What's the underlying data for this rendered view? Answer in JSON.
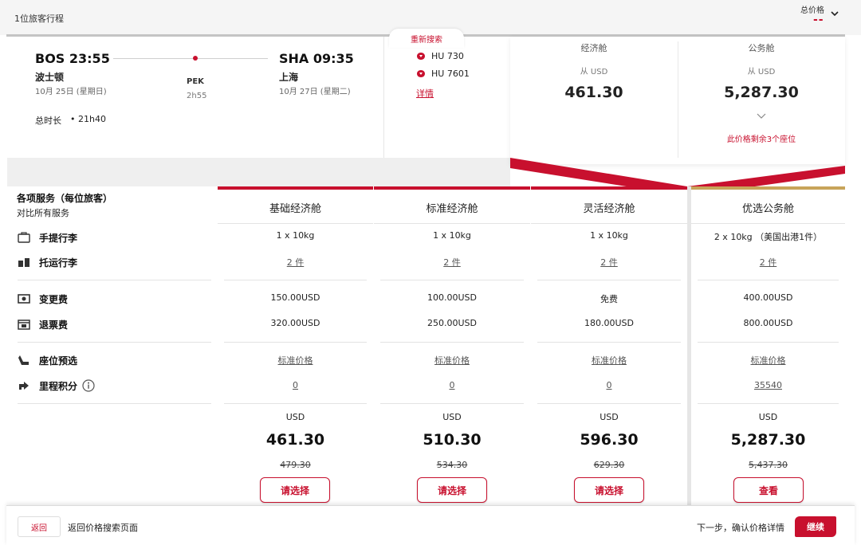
{
  "header": {
    "travelers": "1位旅客行程",
    "total_label": "总价格",
    "total_value": "--"
  },
  "flight": {
    "origin": "BOS 23:55",
    "origin_city": "波士顿",
    "origin_date": "10月 25日 (星期日)",
    "destination": "SHA 09:35",
    "destination_city": "上海",
    "destination_date": "10月 27日 (星期二)",
    "stop": "PEK",
    "layover": "2h55",
    "duration_label": "总时长",
    "duration": "•  21h40"
  },
  "research_label": "重新搜索",
  "flight_numbers": [
    "HU 730",
    "HU 7601"
  ],
  "details_link": "详情",
  "cabins": [
    {
      "name": "经济舱",
      "from": "从 USD",
      "price": "461.30"
    },
    {
      "name": "公务舱",
      "from": "从 USD",
      "price": "5,287.30",
      "seats_note": "此价格剩余3个座位"
    }
  ],
  "services": {
    "title": "各项服务（每位旅客）",
    "subtitle": "对比所有服务",
    "rows": [
      {
        "label": "手提行李",
        "icon": "carry-on-icon"
      },
      {
        "label": "托运行李",
        "icon": "checked-bag-icon"
      },
      {
        "label": "变更费",
        "icon": "change-fee-icon"
      },
      {
        "label": "退票费",
        "icon": "refund-fee-icon"
      },
      {
        "label": "座位预选",
        "icon": "seat-icon"
      },
      {
        "label": "里程积分",
        "icon": "miles-icon"
      }
    ]
  },
  "fares": [
    {
      "name": "基础经济舱",
      "carry_on": "1 x 10kg",
      "checked": "2 件",
      "change": "150.00USD",
      "refund": "320.00USD",
      "seat": "标准价格",
      "miles": "0",
      "currency": "USD",
      "price": "461.30",
      "old_price": "479.30",
      "button": "请选择"
    },
    {
      "name": "标准经济舱",
      "carry_on": "1 x 10kg",
      "checked": "2 件",
      "change": "100.00USD",
      "refund": "250.00USD",
      "seat": "标准价格",
      "miles": "0",
      "currency": "USD",
      "price": "510.30",
      "old_price": "534.30",
      "button": "请选择"
    },
    {
      "name": "灵活经济舱",
      "carry_on": "1 x 10kg",
      "checked": "2 件",
      "change": "免费",
      "refund": "180.00USD",
      "seat": "标准价格",
      "miles": "0",
      "currency": "USD",
      "price": "596.30",
      "old_price": "629.30",
      "button": "请选择"
    },
    {
      "name": "优选公务舱",
      "carry_on": "2 x 10kg （美国出港1件）",
      "checked": "2 件",
      "change": "400.00USD",
      "refund": "800.00USD",
      "seat": "标准价格",
      "miles": "35540",
      "currency": "USD",
      "price": "5,287.30",
      "old_price": "5,437.30",
      "button": "查看"
    }
  ],
  "bottom_bar": {
    "back_button": "返回",
    "back_desc": "返回价格搜索页面",
    "next_text": "下一步，确认价格详情",
    "continue_button": "继续"
  },
  "colors": {
    "accent": "#c8102e",
    "business_accent": "#c8a45a"
  }
}
